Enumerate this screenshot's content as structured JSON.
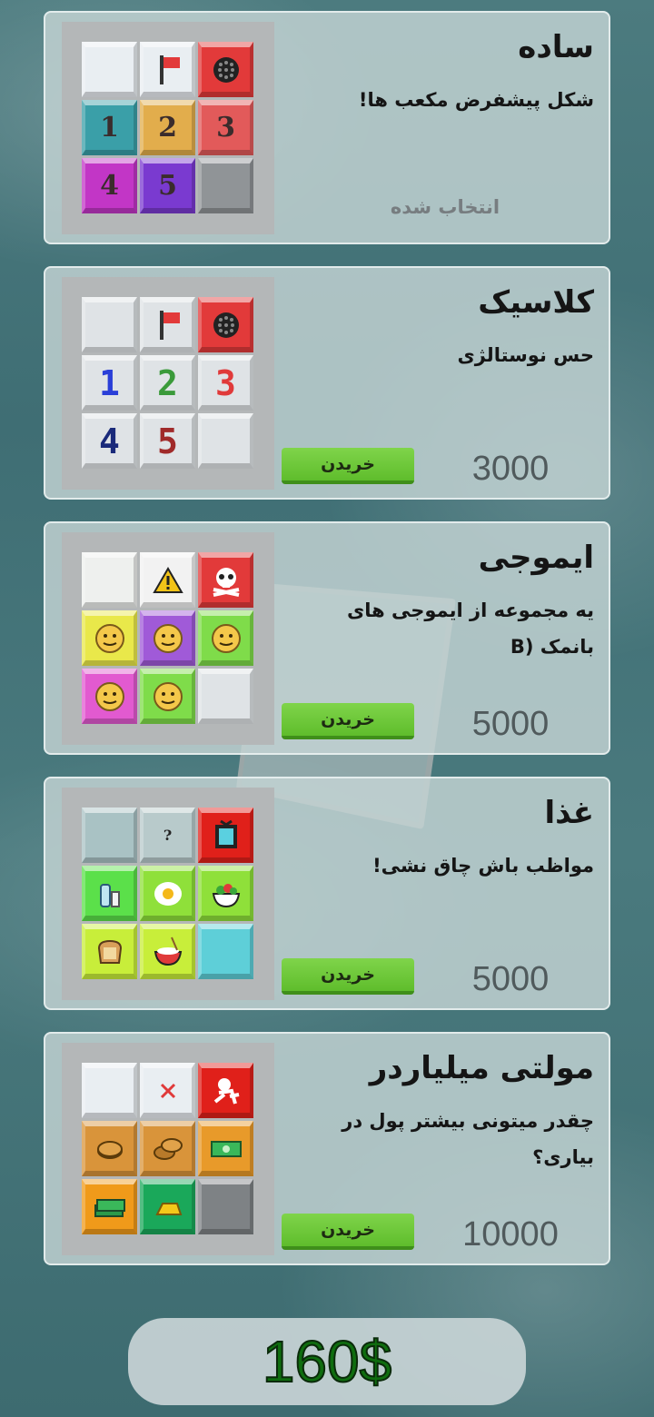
{
  "cards": [
    {
      "title": "ساده",
      "description": "شکل پیشفرض مکعب ها!",
      "status": "انتخاب شده",
      "cubes": [
        {
          "kind": "blank",
          "color": "#e9eef2"
        },
        {
          "kind": "flag-icon",
          "color": "#e9eef2"
        },
        {
          "kind": "mine-icon",
          "color": "#e23a3a"
        },
        {
          "kind": "text",
          "text": "1",
          "color": "#3a9fa8"
        },
        {
          "kind": "text",
          "text": "2",
          "color": "#e2ad4c"
        },
        {
          "kind": "text",
          "text": "3",
          "color": "#e25a5a"
        },
        {
          "kind": "text",
          "text": "4",
          "color": "#c236c6"
        },
        {
          "kind": "text",
          "text": "5",
          "color": "#7a3ad0"
        },
        {
          "kind": "blank",
          "color": "#909497"
        }
      ]
    },
    {
      "title": "کلاسیک",
      "description": "حس نوستالژی",
      "buy_label": "خریدن",
      "price": "3000",
      "cubes": [
        {
          "kind": "blank",
          "color": "#dfe3e6"
        },
        {
          "kind": "flag-icon",
          "color": "#dfe3e6"
        },
        {
          "kind": "mine-icon",
          "color": "#e23a3a"
        },
        {
          "kind": "pixnum",
          "text": "1",
          "color": "#dfe3e6",
          "fg": "#2a3fd8"
        },
        {
          "kind": "pixnum",
          "text": "2",
          "color": "#dfe3e6",
          "fg": "#3a9a3a"
        },
        {
          "kind": "pixnum",
          "text": "3",
          "color": "#dfe3e6",
          "fg": "#e03a3a"
        },
        {
          "kind": "pixnum",
          "text": "4",
          "color": "#dfe3e6",
          "fg": "#1a2a7a"
        },
        {
          "kind": "pixnum",
          "text": "5",
          "color": "#dfe3e6",
          "fg": "#a02a2a"
        },
        {
          "kind": "blank",
          "color": "#dfe3e6"
        }
      ]
    },
    {
      "title": "ایموجی",
      "description": "یه مجموعه از ایموجی های بانمک (B",
      "buy_label": "خریدن",
      "price": "5000",
      "cubes": [
        {
          "kind": "blank",
          "color": "#eef0ee"
        },
        {
          "kind": "warning-icon",
          "color": "#f2f2f2"
        },
        {
          "kind": "skull-icon",
          "color": "#e23a3a"
        },
        {
          "kind": "emoji-icon",
          "color": "#e9e84a"
        },
        {
          "kind": "emoji-icon",
          "color": "#a05ad8"
        },
        {
          "kind": "emoji-icon",
          "color": "#7fdc4a"
        },
        {
          "kind": "emoji-icon",
          "color": "#e25ad0"
        },
        {
          "kind": "emoji-icon",
          "color": "#7fdc4a"
        },
        {
          "kind": "blank",
          "color": "#dfe3e6"
        }
      ]
    },
    {
      "title": "غذا",
      "description": "مواظب باش چاق نشی!",
      "buy_label": "خریدن",
      "price": "5000",
      "cubes": [
        {
          "kind": "blank",
          "color": "#a9c2c4"
        },
        {
          "kind": "text-small",
          "text": "?",
          "color": "#b8cacb"
        },
        {
          "kind": "scale-icon",
          "color": "#e0201a"
        },
        {
          "kind": "bottle-icon",
          "color": "#5be04a"
        },
        {
          "kind": "egg-icon",
          "color": "#8fe03a"
        },
        {
          "kind": "salad-icon",
          "color": "#8fe03a"
        },
        {
          "kind": "bread-icon",
          "color": "#c8ee3a"
        },
        {
          "kind": "bowl-icon",
          "color": "#c8ee3a"
        },
        {
          "kind": "blank",
          "color": "#5ecfd8"
        }
      ]
    },
    {
      "title": "مولتی میلیاردر",
      "description": "چقدر میتونی بیشتر پول در بیاری؟",
      "buy_label": "خریدن",
      "price": "10000",
      "cubes": [
        {
          "kind": "blank",
          "color": "#e9eef2"
        },
        {
          "kind": "cross-icon",
          "color": "#e9eef2"
        },
        {
          "kind": "thief-icon",
          "color": "#e0201a"
        },
        {
          "kind": "coin-icon",
          "color": "#d9943a"
        },
        {
          "kind": "coins-icon",
          "color": "#d9943a"
        },
        {
          "kind": "bill-icon",
          "color": "#e89a2a"
        },
        {
          "kind": "cash-icon",
          "color": "#f09a1a"
        },
        {
          "kind": "gold-icon",
          "color": "#1aa85a"
        },
        {
          "kind": "blank",
          "color": "#7e8285"
        }
      ]
    }
  ],
  "balance": "160$"
}
